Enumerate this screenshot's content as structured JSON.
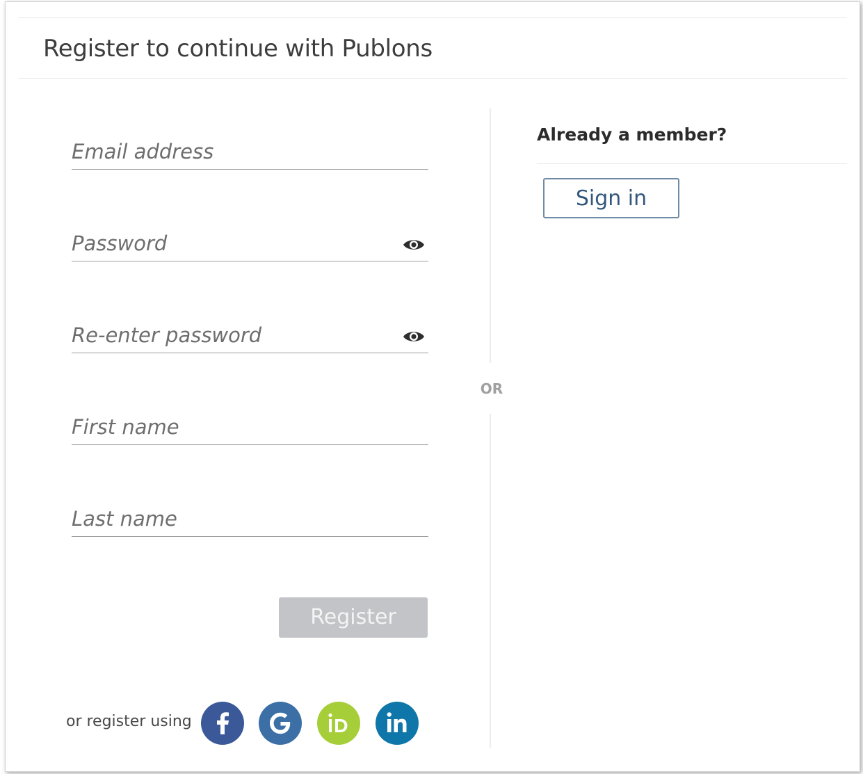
{
  "header": {
    "title": "Register to continue with Publons"
  },
  "form": {
    "email": {
      "placeholder": "Email address",
      "value": ""
    },
    "password": {
      "placeholder": "Password",
      "value": ""
    },
    "reenter_password": {
      "placeholder": "Re-enter password",
      "value": ""
    },
    "first_name": {
      "placeholder": "First name",
      "value": ""
    },
    "last_name": {
      "placeholder": "Last name",
      "value": ""
    },
    "register_label": "Register",
    "password_toggle_icon": "eye-icon"
  },
  "social": {
    "label": "or register using",
    "providers": [
      {
        "name": "facebook",
        "icon": "facebook-icon",
        "color": "#3b5998"
      },
      {
        "name": "google",
        "icon": "google-icon",
        "color": "#3b6fa6"
      },
      {
        "name": "orcid",
        "icon": "orcid-icon",
        "color": "#a6ce39"
      },
      {
        "name": "linkedin",
        "icon": "linkedin-icon",
        "color": "#0e76a8"
      }
    ]
  },
  "divider": {
    "label": "OR"
  },
  "member": {
    "heading": "Already a member?",
    "signin_label": "Sign in"
  },
  "colors": {
    "register_disabled": "#c2c4c8",
    "signin_border": "#6f8aa5",
    "signin_text": "#33577d"
  }
}
